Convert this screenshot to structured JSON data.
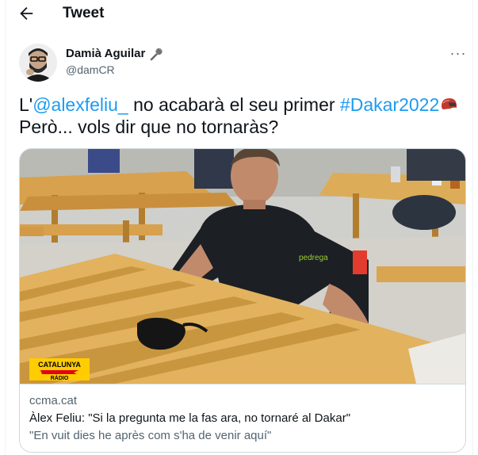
{
  "header": {
    "title": "Tweet",
    "back_icon": "arrow-left-icon"
  },
  "author": {
    "name": "Damià Aguilar",
    "handle": "@damCR",
    "name_emoji": "microphone-icon",
    "avatar": "avatar-photo"
  },
  "tweet": {
    "line1_prefix": "L'",
    "mention": "@alexfeliu_",
    "line1_middle": " no acabarà el seu primer ",
    "hashtag": "#Dakar2022",
    "line2": "Però... vols dir que no tornaràs?",
    "emoji": "helmet-icon"
  },
  "card": {
    "logo_line1": "CATALUNYA",
    "logo_line2": "RÀDIO",
    "domain": "ccma.cat",
    "title": "Àlex Feliu: \"Si la pregunta me la fas ara, no tornaré al Dakar\"",
    "description": "\"En vuit dies he après com s'ha de venir aquí\""
  },
  "colors": {
    "link": "#1d9bf0",
    "text": "#0f1419",
    "muted": "#536471",
    "border": "#cfd9de",
    "cat_yellow": "#ffcc00",
    "cat_red": "#e2001a"
  }
}
